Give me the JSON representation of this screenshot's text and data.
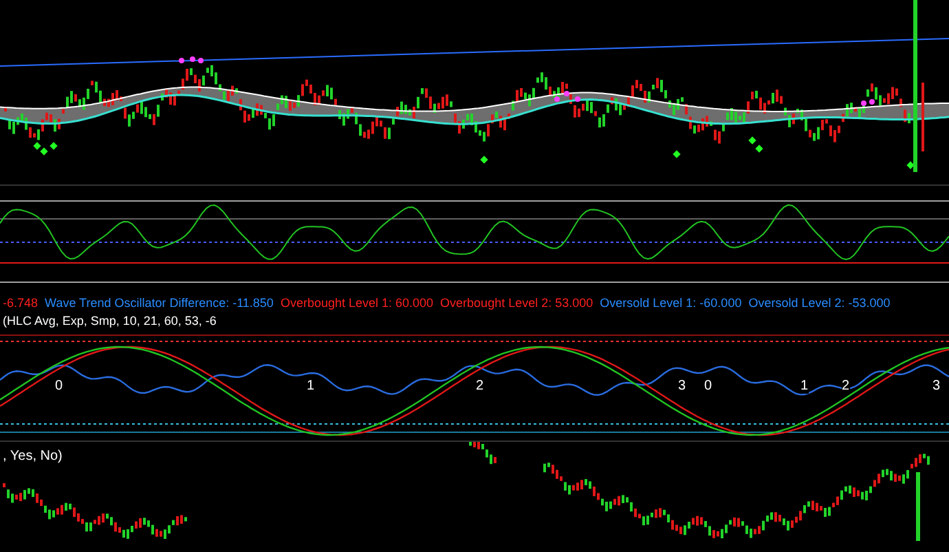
{
  "oscillator_legend": [
    {
      "text": "-6.748",
      "color": "#ff2020"
    },
    {
      "text": "Wave Trend Oscillator Difference: -11.850",
      "color": "#2a8cff"
    },
    {
      "text": "Overbought Level 1: 60.000",
      "color": "#ff2020"
    },
    {
      "text": "Overbought Level 2: 53.000",
      "color": "#ff2020"
    },
    {
      "text": "Oversold Level 1: -60.000",
      "color": "#2a8cff"
    },
    {
      "text": "Oversold Level 2: -53.000",
      "color": "#2a8cff"
    },
    {
      "text": "(HLC Avg, Exp, Smp, 10, 21, 60, 53, -6",
      "color": "#ffffff"
    }
  ],
  "wave_labels": [
    "0",
    "1",
    "2",
    "3",
    "0",
    "1",
    "2",
    "3"
  ],
  "lower_panel": {
    "legend": ", Yes, No)"
  }
}
